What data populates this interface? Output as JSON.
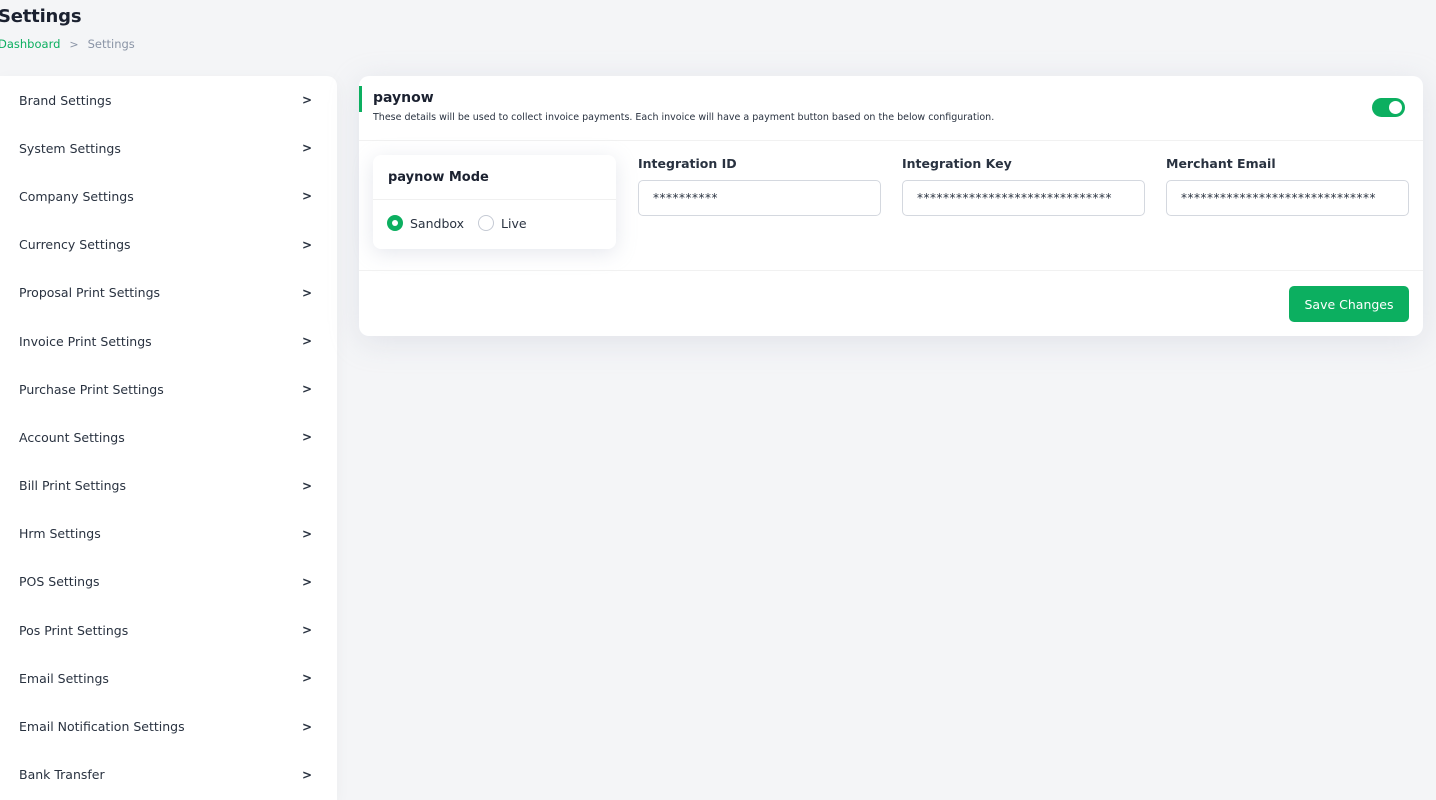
{
  "header": {
    "title": "Settings",
    "breadcrumb": {
      "home": "Dashboard",
      "separator": ">",
      "current": "Settings"
    }
  },
  "sidebar": {
    "items": [
      {
        "label": "Brand Settings"
      },
      {
        "label": "System Settings"
      },
      {
        "label": "Company Settings"
      },
      {
        "label": "Currency Settings"
      },
      {
        "label": "Proposal Print Settings"
      },
      {
        "label": "Invoice Print Settings"
      },
      {
        "label": "Purchase Print Settings"
      },
      {
        "label": "Account Settings"
      },
      {
        "label": "Bill Print Settings"
      },
      {
        "label": "Hrm Settings"
      },
      {
        "label": "POS Settings"
      },
      {
        "label": "Pos Print Settings"
      },
      {
        "label": "Email Settings"
      },
      {
        "label": "Email Notification Settings"
      },
      {
        "label": "Bank Transfer"
      }
    ],
    "chevron_icon": "chevron-right-icon",
    "chevron_glyph": ">"
  },
  "card": {
    "title": "paynow",
    "description": "These details will be used to collect invoice payments. Each invoice will have a payment button based on the below configuration.",
    "enabled": true,
    "mode": {
      "title": "paynow Mode",
      "options": [
        "Sandbox",
        "Live"
      ],
      "selected": "Sandbox"
    },
    "fields": [
      {
        "label": "Integration ID",
        "value": "**********"
      },
      {
        "label": "Integration Key",
        "value": "******************************"
      },
      {
        "label": "Merchant Email",
        "value": "******************************"
      }
    ],
    "save_label": "Save Changes"
  },
  "colors": {
    "accent": "#0caf60",
    "text": "#293240",
    "background": "#f4f5f7"
  }
}
